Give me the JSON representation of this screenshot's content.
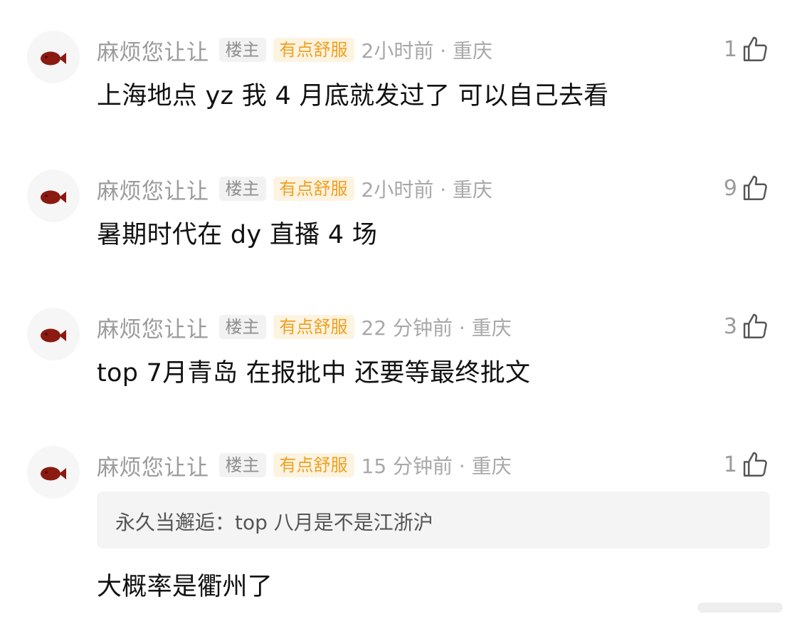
{
  "colors": {
    "username": "#9b9b9b",
    "owner_tag_bg": "#f2f2f2",
    "level_tag_text": "#f0a020",
    "level_tag_bg": "#fdf3e1",
    "meta": "#a8a8a8",
    "avatar_fish": "#8b1a10"
  },
  "comments": [
    {
      "username": "麻烦您让让",
      "owner_tag": "楼主",
      "level_tag": "有点舒服",
      "time_loc": "2小时前 · 重庆",
      "likes": "1",
      "like_icon": "thumbs-up-icon",
      "content": "上海地点 yz 我 4 月底就发过了 可以自己去看"
    },
    {
      "username": "麻烦您让让",
      "owner_tag": "楼主",
      "level_tag": "有点舒服",
      "time_loc": "2小时前 · 重庆",
      "likes": "9",
      "like_icon": "thumbs-up-icon",
      "content": "暑期时代在 dy 直播 4 场"
    },
    {
      "username": "麻烦您让让",
      "owner_tag": "楼主",
      "level_tag": "有点舒服",
      "time_loc": "22 分钟前 · 重庆",
      "likes": "3",
      "like_icon": "thumbs-up-icon",
      "content": "top 7月青岛 在报批中 还要等最终批文"
    },
    {
      "username": "麻烦您让让",
      "owner_tag": "楼主",
      "level_tag": "有点舒服",
      "time_loc": "15 分钟前 · 重庆",
      "likes": "1",
      "like_icon": "thumbs-up-icon",
      "quote": "永久当邂逅：top 八月是不是江浙沪",
      "content": "大概率是衢州了"
    }
  ]
}
